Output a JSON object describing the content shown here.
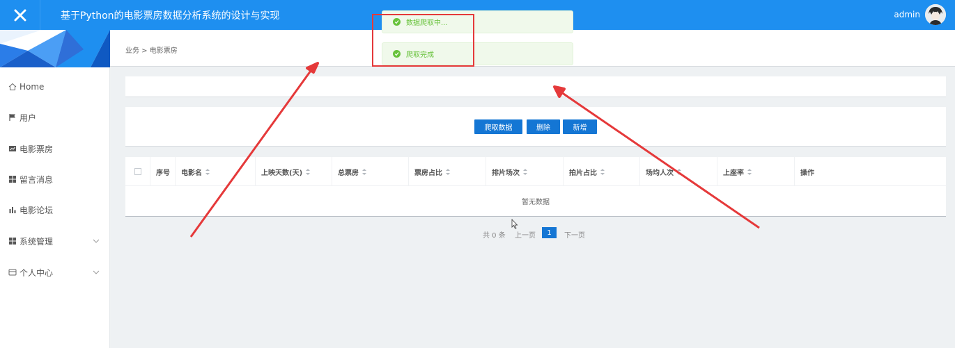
{
  "header": {
    "title": "基于Python的电影票房数据分析系统的设计与实现",
    "user": "admin",
    "bg_color": "#1e8ff0"
  },
  "sidebar": {
    "items": [
      {
        "label": "Home",
        "icon": "home-icon"
      },
      {
        "label": "用户",
        "icon": "flag-icon"
      },
      {
        "label": "电影票房",
        "icon": "chart-icon"
      },
      {
        "label": "留言消息",
        "icon": "grid-icon"
      },
      {
        "label": "电影论坛",
        "icon": "bar-chart-icon"
      },
      {
        "label": "系统管理",
        "icon": "grid-icon",
        "expandable": true
      },
      {
        "label": "个人中心",
        "icon": "card-icon",
        "expandable": true
      }
    ]
  },
  "breadcrumb": "业务 > 电影票房",
  "toasts": [
    {
      "text": "数据爬取中..."
    },
    {
      "text": "爬取完成"
    }
  ],
  "actions": {
    "crawl": "爬取数据",
    "delete": "删除",
    "add": "新增",
    "accent_color": "#1476d4"
  },
  "table": {
    "columns": [
      "序号",
      "电影名",
      "上映天数(天)",
      "总票房",
      "票房占比",
      "排片场次",
      "拍片占比",
      "场均人次",
      "上座率",
      "操作"
    ],
    "empty_text": "暂无数据"
  },
  "pagination": {
    "total": "共 0 条",
    "prev": "上一页",
    "current": "1",
    "next": "下一页"
  },
  "annotation_color": "#e5393a"
}
